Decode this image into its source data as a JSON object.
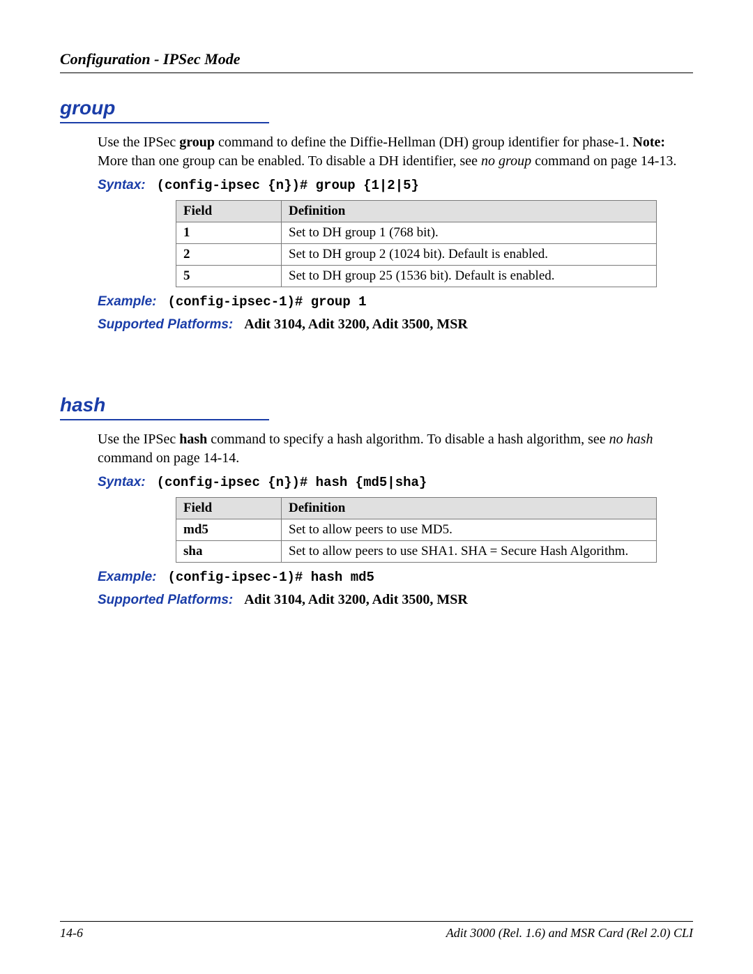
{
  "header": "Configuration - IPSec Mode",
  "sections": [
    {
      "title": "group",
      "desc_html": "Use the IPSec <b>group</b> command to define the Diffie-Hellman (DH) group identifier for phase-1. <b>Note:</b> More than one group can be enabled. To disable a DH identifier, see <i>no group</i> command on page 14-13.",
      "syntax_label": "Syntax:",
      "syntax": "(config-ipsec {n})# group {1|2|5}",
      "table": {
        "head": [
          "Field",
          "Definition"
        ],
        "rows": [
          [
            "1",
            "Set to DH group 1 (768 bit)."
          ],
          [
            "2",
            "Set to DH group 2 (1024 bit). Default is enabled."
          ],
          [
            "5",
            "Set to DH group 25 (1536 bit). Default is enabled."
          ]
        ]
      },
      "example_label": "Example:",
      "example": "(config-ipsec-1)# group 1",
      "platforms_label": "Supported Platforms:",
      "platforms": "Adit 3104, Adit 3200, Adit 3500, MSR"
    },
    {
      "title": "hash",
      "desc_html": "Use the IPSec <b>hash</b> command to specify a hash algorithm. To disable a hash algorithm, see <i>no hash</i> command on page 14-14.",
      "syntax_label": "Syntax:",
      "syntax": "(config-ipsec {n})# hash {md5|sha}",
      "table": {
        "head": [
          "Field",
          "Definition"
        ],
        "rows": [
          [
            "md5",
            "Set to allow peers to use MD5."
          ],
          [
            "sha",
            "Set to allow peers to use SHA1.  SHA = Secure Hash Algorithm."
          ]
        ]
      },
      "example_label": "Example:",
      "example": "(config-ipsec-1)# hash md5",
      "platforms_label": "Supported Platforms:",
      "platforms": "Adit 3104, Adit 3200, Adit 3500, MSR"
    }
  ],
  "footer": {
    "left": "14-6",
    "right": "Adit 3000 (Rel. 1.6) and MSR Card (Rel 2.0) CLI"
  }
}
